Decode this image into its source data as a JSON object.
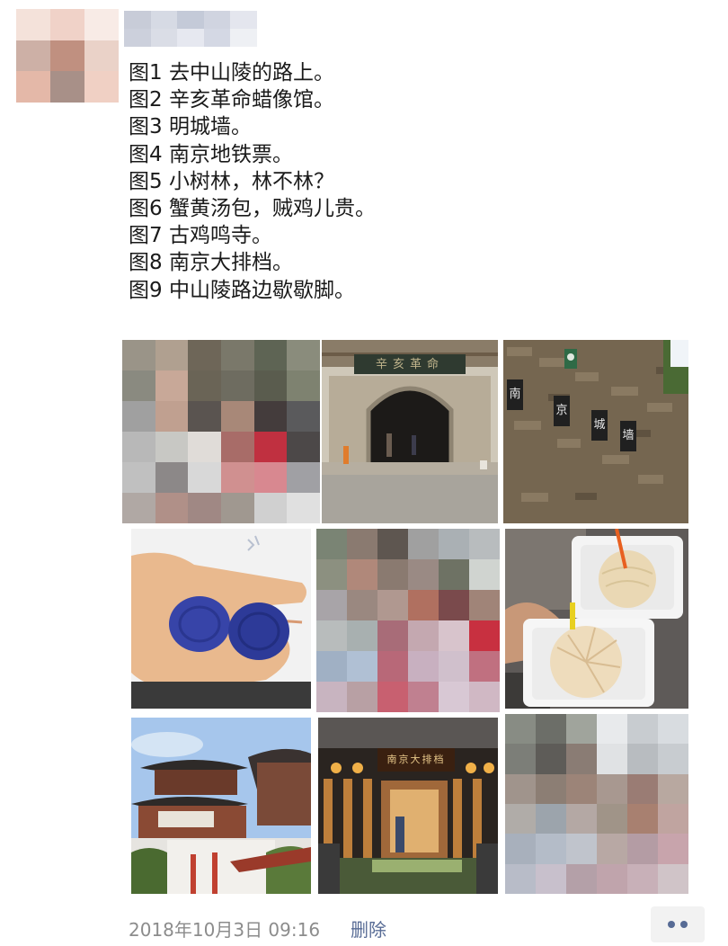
{
  "post": {
    "lines": [
      "图1 去中山陵的路上。",
      "图2 辛亥革命蜡像馆。",
      "图3 明城墙。",
      "图4 南京地铁票。",
      "图5 小树林，林不林？",
      "图6 蟹黄汤包，贼鸡儿贵。",
      "图7 古鸡鸣寺。",
      "图8 南京大排档。",
      "图9 中山陵路边歇歇脚。"
    ],
    "timestamp": "2018年10月3日 09:16",
    "delete_label": "删除"
  },
  "photos": [
    {
      "caption_ref": "图1",
      "blurred": true
    },
    {
      "caption_ref": "图2",
      "blurred": false,
      "sign_text": "辛亥革命"
    },
    {
      "caption_ref": "图3",
      "blurred": false,
      "sign_chars": [
        "南",
        "京",
        "城",
        "墙"
      ]
    },
    {
      "caption_ref": "图4",
      "blurred": false
    },
    {
      "caption_ref": "图5",
      "blurred": true
    },
    {
      "caption_ref": "图6",
      "blurred": false
    },
    {
      "caption_ref": "图7",
      "blurred": false
    },
    {
      "caption_ref": "图8",
      "blurred": false,
      "sign_text": "南京大排档"
    },
    {
      "caption_ref": "图9",
      "blurred": true
    }
  ],
  "colors": {
    "link": "#576b95",
    "meta_text": "#8c8c8c",
    "body_text": "#1a1a1a"
  }
}
